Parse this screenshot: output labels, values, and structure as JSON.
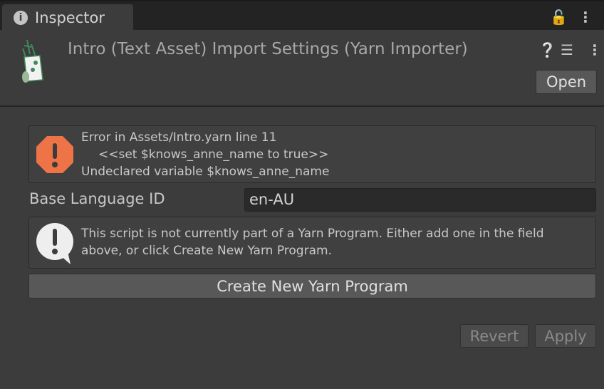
{
  "tab": {
    "label": "Inspector",
    "icon": "info-icon"
  },
  "header": {
    "title": "Intro (Text Asset) Import Settings (Yarn Importer)",
    "open_label": "Open"
  },
  "error": {
    "lines": [
      "Error in Assets/Intro.yarn line 11",
      "<<set $knows_anne_name to true>>",
      "Undeclared variable $knows_anne_name"
    ],
    "color": "#ee7448"
  },
  "base_language": {
    "label": "Base Language ID",
    "value": "en-AU"
  },
  "info": {
    "text": "This script is not currently part of a Yarn Program. Either add one in the field above, or click Create New Yarn Program."
  },
  "create_label": "Create New Yarn Program",
  "revert_label": "Revert",
  "apply_label": "Apply"
}
